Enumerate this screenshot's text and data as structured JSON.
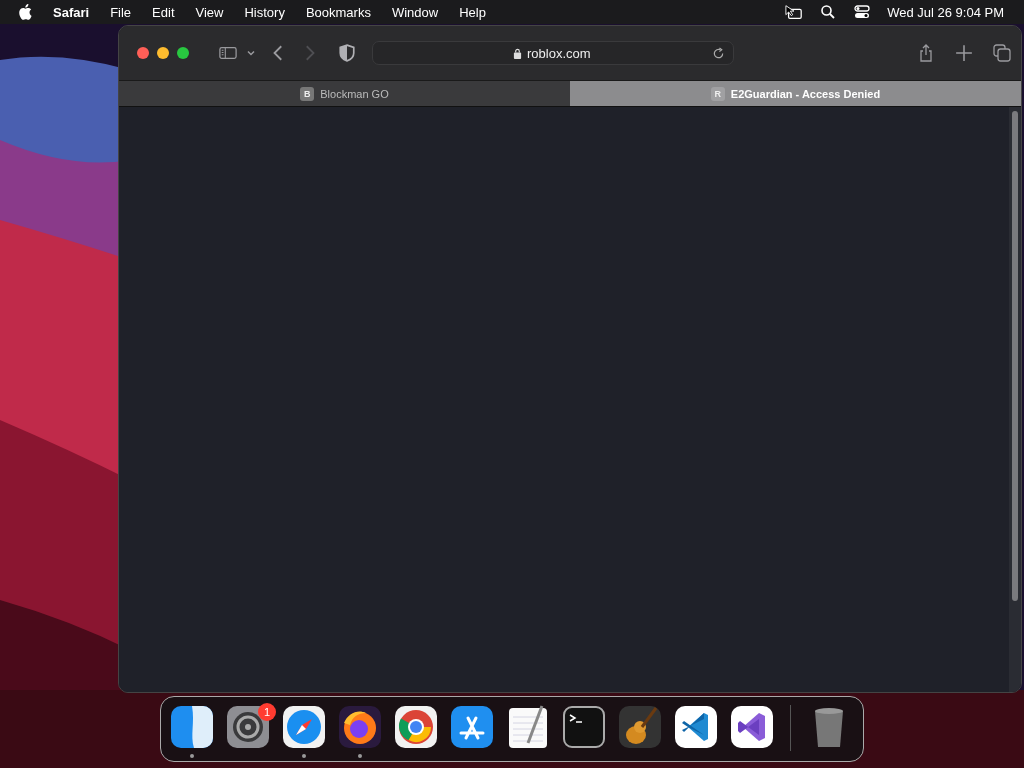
{
  "menu_bar": {
    "app_name": "Safari",
    "items": [
      "File",
      "Edit",
      "View",
      "History",
      "Bookmarks",
      "Window",
      "Help"
    ],
    "clock": "Wed Jul 26  9:04 PM"
  },
  "window": {
    "address": "roblox.com",
    "tabs": [
      {
        "favicon": "B",
        "title": "Blockman GO",
        "selected": false
      },
      {
        "favicon": "R",
        "title": "E2Guardian - Access Denied",
        "selected": true
      }
    ]
  },
  "dock": {
    "apps": [
      {
        "kind": "finder",
        "running": true
      },
      {
        "kind": "settings",
        "running": false,
        "badge": "1"
      },
      {
        "kind": "safari",
        "running": true
      },
      {
        "kind": "firefox",
        "running": true
      },
      {
        "kind": "chrome",
        "running": false
      },
      {
        "kind": "appstore",
        "running": false
      },
      {
        "kind": "textedit",
        "running": false
      },
      {
        "kind": "terminal",
        "running": false
      },
      {
        "kind": "garageband",
        "running": false
      },
      {
        "kind": "vscode",
        "running": false
      },
      {
        "kind": "visualstudio",
        "running": false
      }
    ],
    "trash": true
  }
}
